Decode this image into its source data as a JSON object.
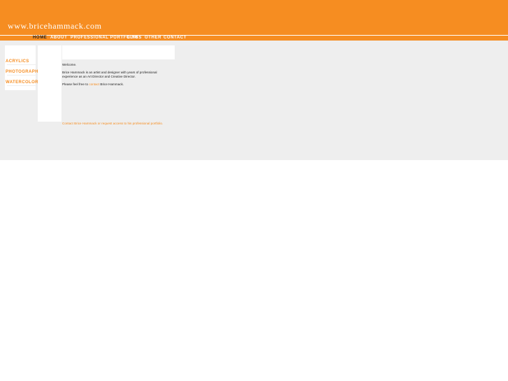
{
  "site": {
    "title": "www.bricehammack.com"
  },
  "nav": {
    "items": [
      {
        "label": "HOME",
        "active": true
      },
      {
        "label": "ABOUT"
      },
      {
        "label": "PROFESSIONAL PORTFOLIO"
      },
      {
        "label": "LINKS"
      },
      {
        "label": "OTHER"
      },
      {
        "label": "CONTACT"
      }
    ]
  },
  "sidebar": {
    "items": [
      {
        "label": "ACRYLICS"
      },
      {
        "label": "PHOTOGRAPHY"
      },
      {
        "label": "WATERCOLORS"
      }
    ]
  },
  "main": {
    "welcome": "Welcome.",
    "bio_line1": "Brice Hammack is an artist and designer with years of professional",
    "bio_line2": "experience as an Art Director and Creative Director.",
    "contact_prefix": "Please feel free to ",
    "contact_link": "contact",
    "contact_suffix": " Brice Hammack.",
    "footer_link": "Contact Brice Hammack or request access to his professional portfolio."
  },
  "colors": {
    "brand_orange": "#f68d21",
    "panel_gray": "#eeeeee"
  }
}
